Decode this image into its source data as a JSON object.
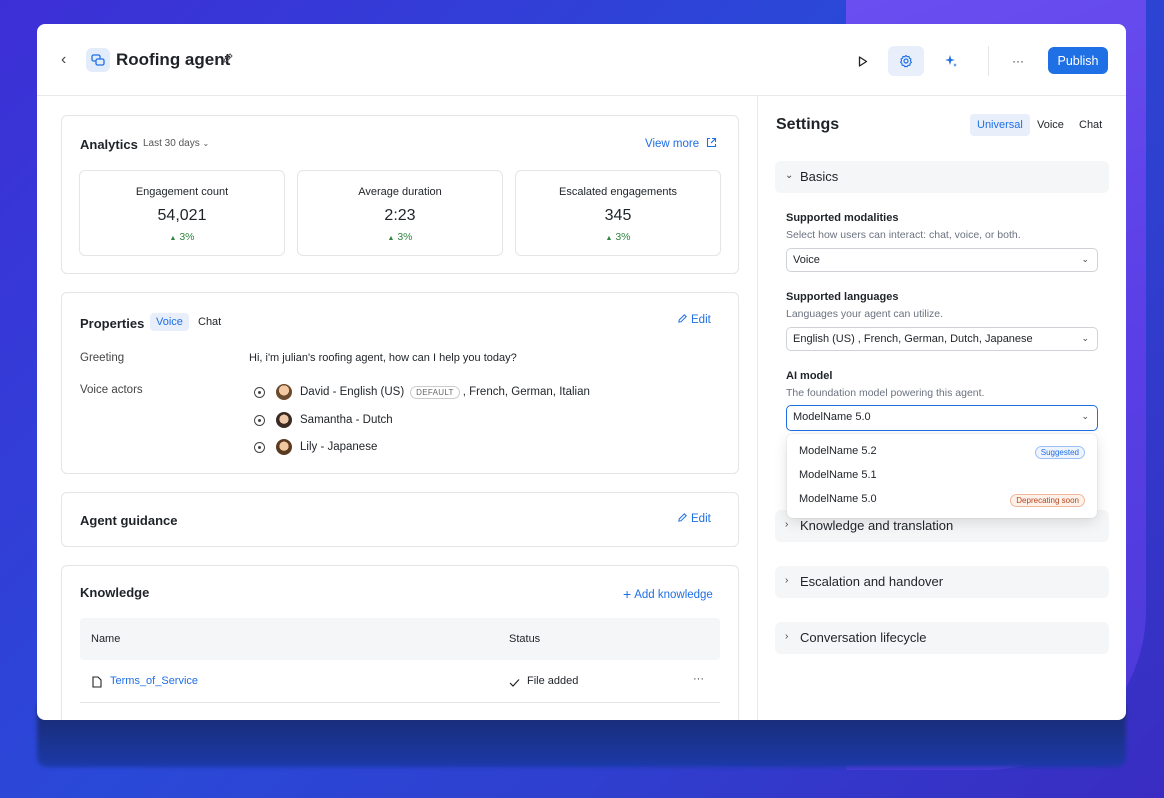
{
  "header": {
    "back_icon": "chevron-left-icon",
    "agent_icon": "agent-icon",
    "title": "Roofing agent",
    "publish_label": "Publish",
    "more_label": "···",
    "accent": "#1f6fe5"
  },
  "analytics": {
    "title": "Analytics",
    "range": "Last 30 days",
    "view_more": "View more",
    "metrics": [
      {
        "label": "Engagement count",
        "value": "54,021",
        "delta": "3%"
      },
      {
        "label": "Average duration",
        "value": "2:23",
        "delta": "3%"
      },
      {
        "label": "Escalated engagements",
        "value": "345",
        "delta": "3%"
      }
    ]
  },
  "properties": {
    "title": "Properties",
    "tabs": [
      "Voice",
      "Chat"
    ],
    "edit": "Edit",
    "greeting_label": "Greeting",
    "greeting_value": "Hi, i'm julian's roofing agent, how can I help you today?",
    "voice_actors_label": "Voice actors",
    "actors": [
      {
        "name": "David - English (US)",
        "badge": "DEFAULT",
        "extra": ", French, German, Italian"
      },
      {
        "name": "Samantha - Dutch",
        "badge": "",
        "extra": ""
      },
      {
        "name": "Lily - Japanese",
        "badge": "",
        "extra": ""
      }
    ]
  },
  "guidance": {
    "title": "Agent guidance",
    "edit": "Edit"
  },
  "knowledge": {
    "title": "Knowledge",
    "add": "Add knowledge",
    "columns": [
      "Name",
      "Status"
    ],
    "rows": [
      {
        "name": "Terms_of_Service",
        "status": "File added",
        "more": "···"
      }
    ]
  },
  "settings": {
    "title": "Settings",
    "segments": [
      "Universal",
      "Voice",
      "Chat"
    ],
    "basics": "Basics",
    "modalities_label": "Supported modalities",
    "modalities_help": "Select how users can interact: chat, voice, or both.",
    "modalities_value": "Voice",
    "languages_label": "Supported languages",
    "languages_help": "Languages your agent can utilize.",
    "languages_value": "English (US) , French, German, Dutch, Japanese",
    "model_label": "AI model",
    "model_help": "The foundation model powering this agent.",
    "model_value": "ModelName 5.0",
    "model_options": [
      {
        "label": "ModelName 5.2",
        "badge": "Suggested"
      },
      {
        "label": "ModelName 5.1",
        "badge": ""
      },
      {
        "label": "ModelName 5.0",
        "badge": "Deprecating soon"
      }
    ],
    "sections": [
      "Knowledge and translation",
      "Escalation and handover",
      "Conversation lifecycle"
    ]
  }
}
